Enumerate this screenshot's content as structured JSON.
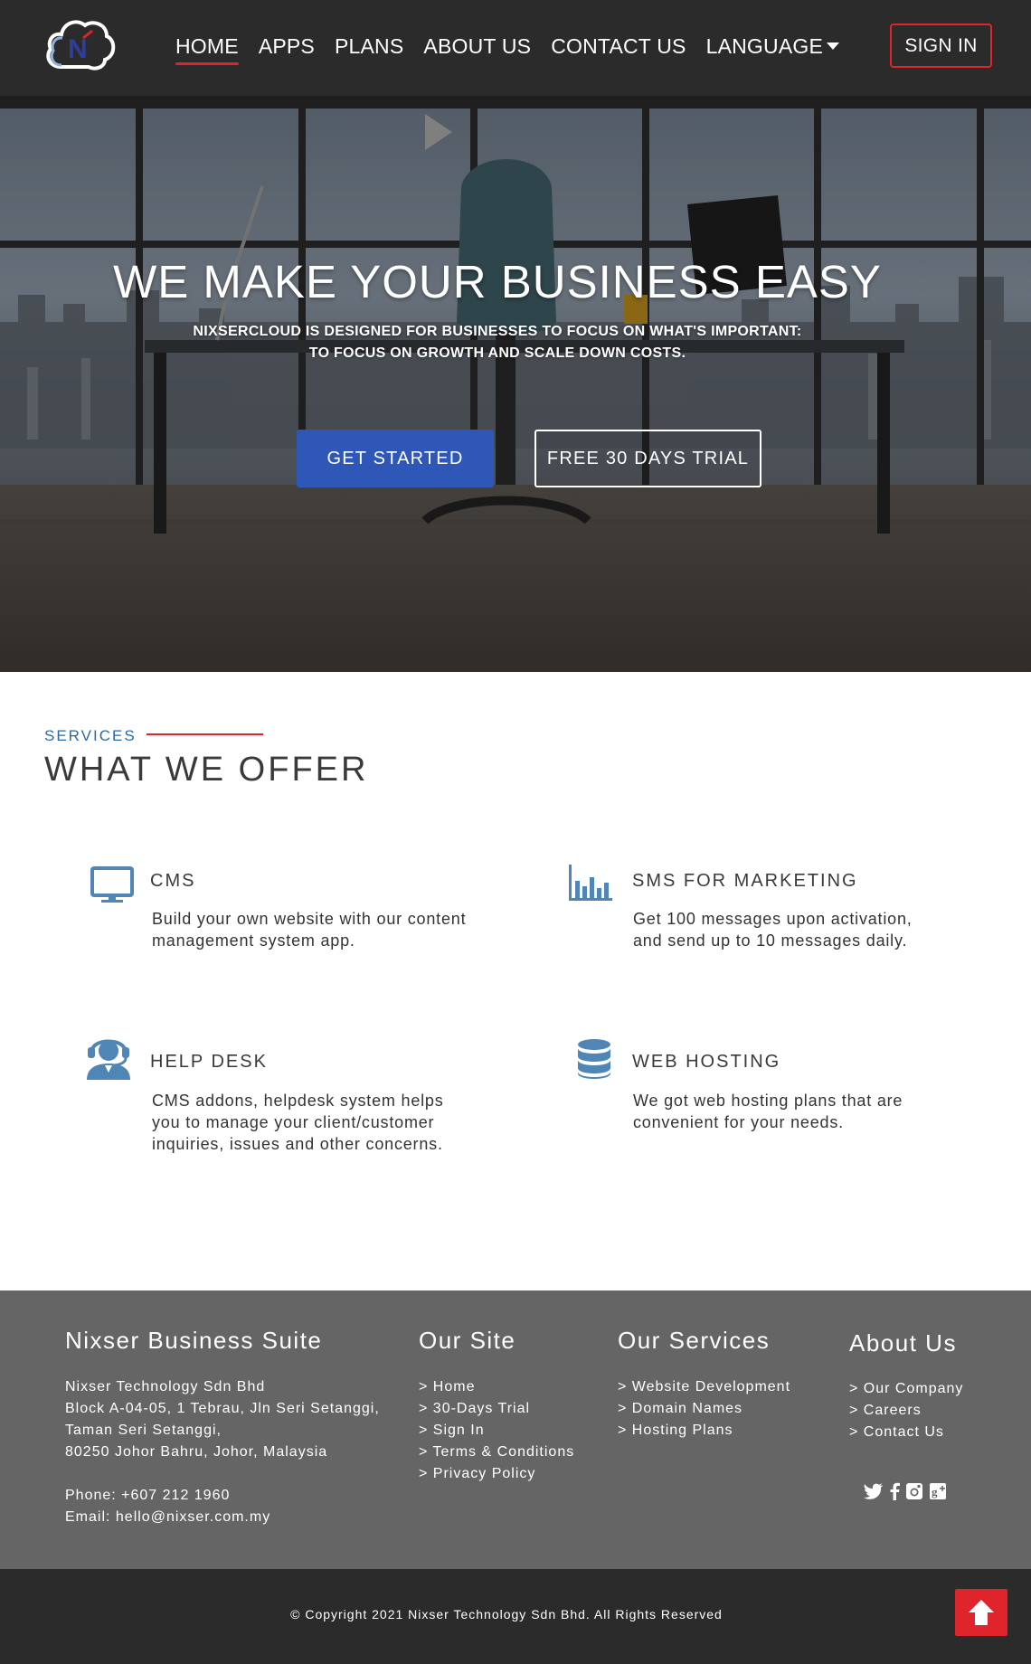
{
  "header": {
    "nav": [
      {
        "label": "HOME"
      },
      {
        "label": "APPS"
      },
      {
        "label": "PLANS"
      },
      {
        "label": "ABOUT US"
      },
      {
        "label": "CONTACT US"
      },
      {
        "label": "LANGUAGE"
      }
    ],
    "sign_in": "SIGN IN",
    "logo_letter": "N"
  },
  "hero": {
    "title": "WE MAKE YOUR BUSINESS EASY",
    "subtitle_line1": "NIXSERCLOUD IS DESIGNED FOR BUSINESSES TO FOCUS ON WHAT'S IMPORTANT:",
    "subtitle_line2": "TO FOCUS ON GROWTH AND SCALE DOWN COSTS.",
    "cta_primary": "GET STARTED",
    "cta_secondary": "FREE 30 DAYS TRIAL"
  },
  "services": {
    "label": "SERVICES",
    "title": "WHAT WE OFFER",
    "items": [
      {
        "icon": "monitor-icon",
        "name": "CMS",
        "desc_line1": "Build your own website with our content",
        "desc_line2": "management system app.",
        "desc_line3": ""
      },
      {
        "icon": "bar-chart-icon",
        "name": "SMS FOR MARKETING",
        "desc_line1": "Get 100 messages upon activation,",
        "desc_line2": "and send up to 10 messages daily.",
        "desc_line3": ""
      },
      {
        "icon": "headset-icon",
        "name": "HELP DESK",
        "desc_line1": "CMS addons, helpdesk system helps",
        "desc_line2": "you to manage your client/customer",
        "desc_line3": "inquiries, issues and other concerns."
      },
      {
        "icon": "database-icon",
        "name": "WEB HOSTING",
        "desc_line1": "We got web hosting plans that are",
        "desc_line2": "convenient for your needs.",
        "desc_line3": ""
      }
    ]
  },
  "footer": {
    "company": {
      "title": "Nixser Business Suite",
      "lines": [
        "Nixser Technology Sdn Bhd",
        "Block A-04-05, 1 Tebrau, Jln Seri Setanggi,",
        "Taman Seri Setanggi,",
        "80250 Johor Bahru, Johor, Malaysia"
      ],
      "phone": "Phone: +607 212 1960",
      "email": "Email: hello@nixser.com.my"
    },
    "our_site": {
      "title": "Our Site",
      "links": [
        "> Home",
        "> 30-Days Trial",
        "> Sign In",
        "> Terms & Conditions",
        "> Privacy Policy"
      ]
    },
    "our_services": {
      "title": "Our Services",
      "links": [
        "> Website Development",
        "> Domain Names",
        "> Hosting Plans"
      ]
    },
    "about_us": {
      "title": "About Us",
      "links": [
        "> Our Company",
        "> Careers",
        "> Contact Us"
      ]
    },
    "socials": [
      "twitter-icon",
      "facebook-icon",
      "instagram-icon",
      "google-plus-icon"
    ],
    "copyright": "© Copyright 2021 Nixser Technology Sdn Bhd. All Rights Reserved"
  },
  "colors": {
    "header_bg": "#2b2b2b",
    "accent_red": "#e0242b",
    "primary_blue": "#2e57b8",
    "icon_blue": "#4f86b6",
    "footer_bg": "#656565"
  }
}
